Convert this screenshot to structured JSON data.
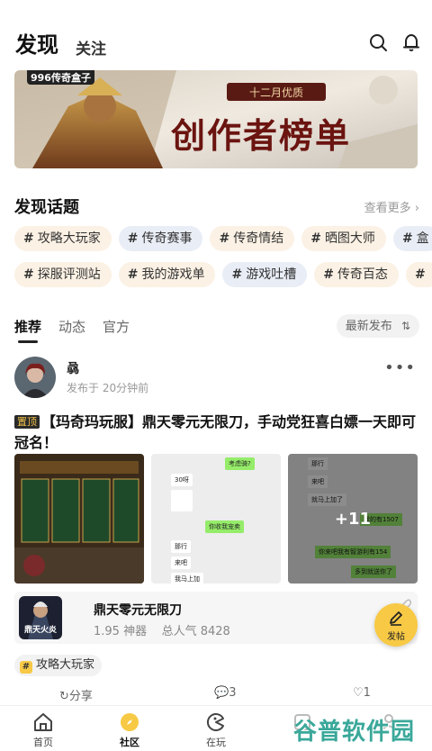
{
  "header": {
    "tab_discover": "发现",
    "tab_follow": "关注"
  },
  "banner": {
    "logo_text": "996传奇盒子",
    "subtitle": "十二月优质",
    "title": "创作者榜单"
  },
  "topics": {
    "title": "发现话题",
    "see_more": "查看更多",
    "row1": [
      "攻略大玩家",
      "传奇赛事",
      "传奇情结",
      "晒图大师",
      "盒"
    ],
    "row2": [
      "探服评测站",
      "我的游戏单",
      "游戏吐槽",
      "传奇百态",
      ""
    ]
  },
  "feed_tabs": {
    "items": [
      "推荐",
      "动态",
      "官方"
    ],
    "sort_label": "最新发布"
  },
  "post": {
    "author": "骉",
    "time": "发布于 20分钟前",
    "pin_label": "置顶",
    "title": "【玛奇玛玩服】鼎天零元无限刀，手动党狂喜白嫖一天即可冠名！",
    "more_count": "+11",
    "chat": {
      "msg1": "考虑骑?",
      "msg2": "30呀",
      "msg3": "你收我宠卖",
      "msg4": "那行",
      "msg5": "来吧",
      "msg6": "我马上加",
      "c3_1": "那行",
      "c3_2": "来吧",
      "c3_3": "就马上加了",
      "c3_4": "我的有1507",
      "c3_5": "你来吧我有智游利有154",
      "c3_6": "多到就送你了"
    },
    "game": {
      "name": "鼎天零元无限刀",
      "meta": "1.95 神器    总人气 8428",
      "icon_text": "鼎天火炎"
    },
    "topic_tag": "攻略大玩家",
    "actions": {
      "share": "分享",
      "comments": "3",
      "likes": "1"
    }
  },
  "fab": {
    "label": "发帖"
  },
  "tabbar": {
    "items": [
      "首页",
      "社区",
      "在玩",
      "",
      ""
    ]
  },
  "watermark": {
    "text": "谷普软件园"
  },
  "colors": {
    "accent": "#f7c945",
    "chip_warm": "#fbf1e4",
    "chip_cool": "#e9edf6"
  }
}
